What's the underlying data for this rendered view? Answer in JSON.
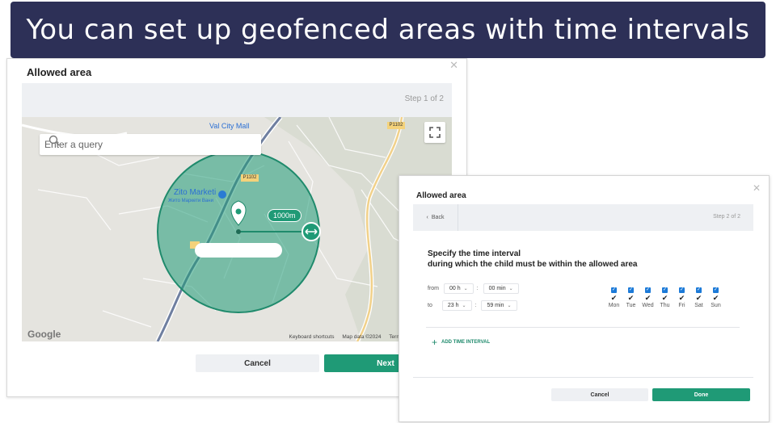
{
  "banner": {
    "text": "You can set up geofenced areas with time intervals"
  },
  "dialog1": {
    "title": "Allowed area",
    "step": "Step 1 of 2",
    "search": {
      "placeholder": "Enter a query",
      "value": ""
    },
    "map": {
      "place_label": "Zito Marketi",
      "place_sublabel": "Жито Маркети Вани",
      "mall_label": "Val City Mall",
      "road_tag_1": "P1102",
      "road_tag_2": "P1102",
      "radius_label": "1000m",
      "google_logo": "Google",
      "attribution": [
        "Keyboard shortcuts",
        "Map data ©2024",
        "Terms"
      ]
    },
    "buttons": {
      "cancel": "Cancel",
      "next": "Next"
    },
    "colors": {
      "accent": "#1f9a76",
      "circle_fill": "#1f9a76"
    }
  },
  "dialog2": {
    "title": "Allowed area",
    "back": "Back",
    "step": "Step 2 of 2",
    "heading_line1": "Specify the time interval",
    "heading_line2": "during which the child must be within the allowed area",
    "from": {
      "label": "from",
      "hours": "00 h",
      "minutes": "00 min"
    },
    "to": {
      "label": "to",
      "hours": "23 h",
      "minutes": "59 min"
    },
    "days": [
      {
        "name": "Mon",
        "checked": true
      },
      {
        "name": "Tue",
        "checked": true
      },
      {
        "name": "Wed",
        "checked": true
      },
      {
        "name": "Thu",
        "checked": true
      },
      {
        "name": "Fri",
        "checked": true
      },
      {
        "name": "Sat",
        "checked": true
      },
      {
        "name": "Sun",
        "checked": true
      }
    ],
    "add_interval": "ADD TIME INTERVAL",
    "buttons": {
      "cancel": "Cancel",
      "done": "Done"
    }
  }
}
